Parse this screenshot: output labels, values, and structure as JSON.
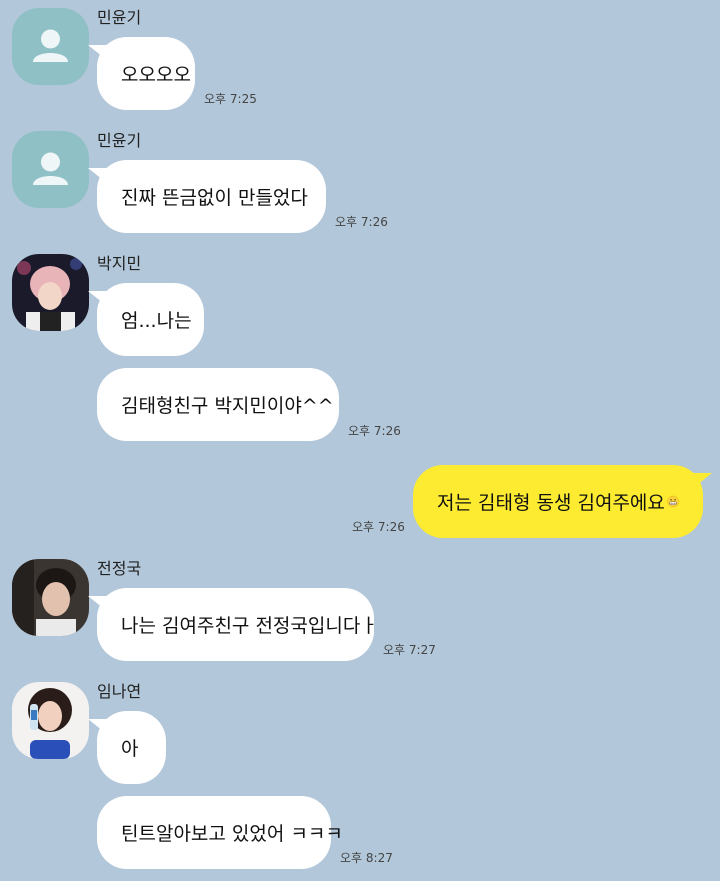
{
  "chat": {
    "messages": [
      {
        "sender": "민윤기",
        "text": "오오오오",
        "time": "오후 7:25"
      },
      {
        "sender": "민윤기",
        "text": "진짜 뜬금없이 만들었다",
        "time": "오후 7:26"
      },
      {
        "sender": "박지민",
        "text": "엄...나는"
      },
      {
        "text": "김태형친구 박지민이야^^",
        "time": "오후 7:26"
      },
      {
        "mine": true,
        "text": "저는 김태형 동생 김여주에요",
        "time": "오후 7:26",
        "emoji": "grinning-face-emoji"
      },
      {
        "sender": "전정국",
        "text": "나는 김여주친구 전정국입니다ㅏ",
        "time": "오후 7:27"
      },
      {
        "sender": "임나연",
        "text": "아"
      },
      {
        "text": "틴트알아보고 있었어 ㅋㅋㅋ",
        "time": "오후 8:27"
      }
    ]
  },
  "colors": {
    "background": "#b2c7d9",
    "incoming_bubble": "#ffffff",
    "outgoing_bubble": "#fdeb32",
    "default_avatar": "#8fc0c6"
  }
}
